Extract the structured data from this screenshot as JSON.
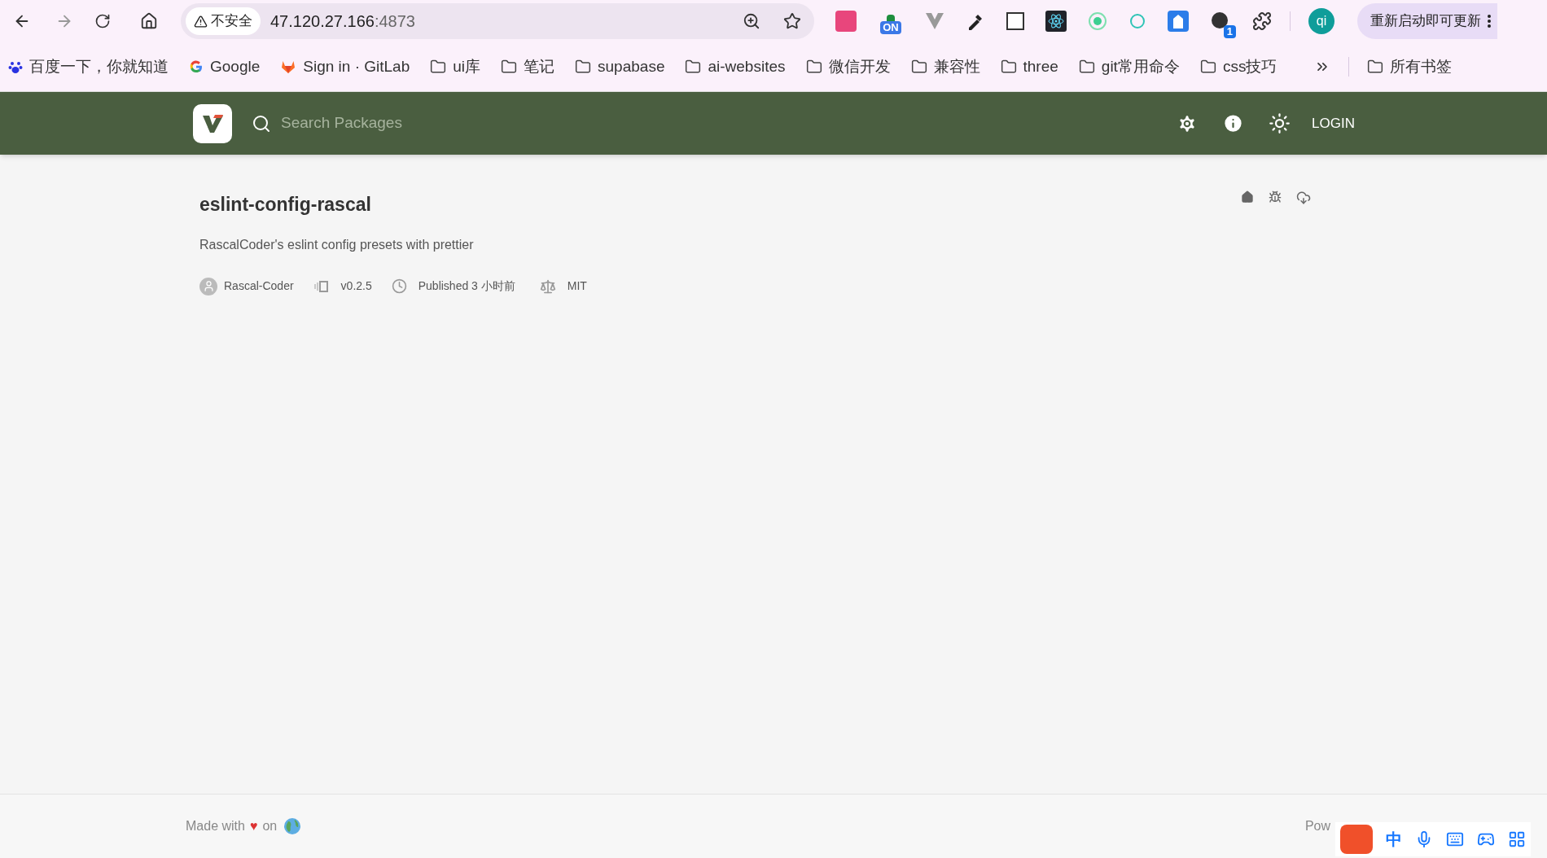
{
  "browser": {
    "security_label": "不安全",
    "address_host": "47.120.27.166",
    "address_port": ":4873",
    "extension_badge": "1",
    "extension_on_label": "ON",
    "profile_initials": "qi",
    "update_button": "重新启动即可更新"
  },
  "bookmarks": [
    {
      "kind": "baidu",
      "label": "百度一下，你就知道"
    },
    {
      "kind": "google",
      "label": "Google"
    },
    {
      "kind": "gitlab",
      "label": "Sign in · GitLab"
    },
    {
      "kind": "folder",
      "label": "ui库"
    },
    {
      "kind": "folder",
      "label": "笔记"
    },
    {
      "kind": "folder",
      "label": "supabase"
    },
    {
      "kind": "folder",
      "label": "ai-websites"
    },
    {
      "kind": "folder",
      "label": "微信开发"
    },
    {
      "kind": "folder",
      "label": "兼容性"
    },
    {
      "kind": "folder",
      "label": "three"
    },
    {
      "kind": "folder",
      "label": "git常用命令"
    },
    {
      "kind": "folder",
      "label": "css技巧"
    }
  ],
  "all_bookmarks": "所有书签",
  "header": {
    "search_placeholder": "Search Packages",
    "login": "LOGIN"
  },
  "package": {
    "name": "eslint-config-rascal",
    "description": "RascalCoder's eslint config presets with prettier",
    "author": "Rascal-Coder",
    "version": "v0.2.5",
    "published": "Published 3 小时前",
    "license": "MIT"
  },
  "footer": {
    "made_with": "Made with",
    "heart": "♥",
    "on": "on",
    "powered": "Pow"
  },
  "ime": {
    "mode": "中"
  }
}
